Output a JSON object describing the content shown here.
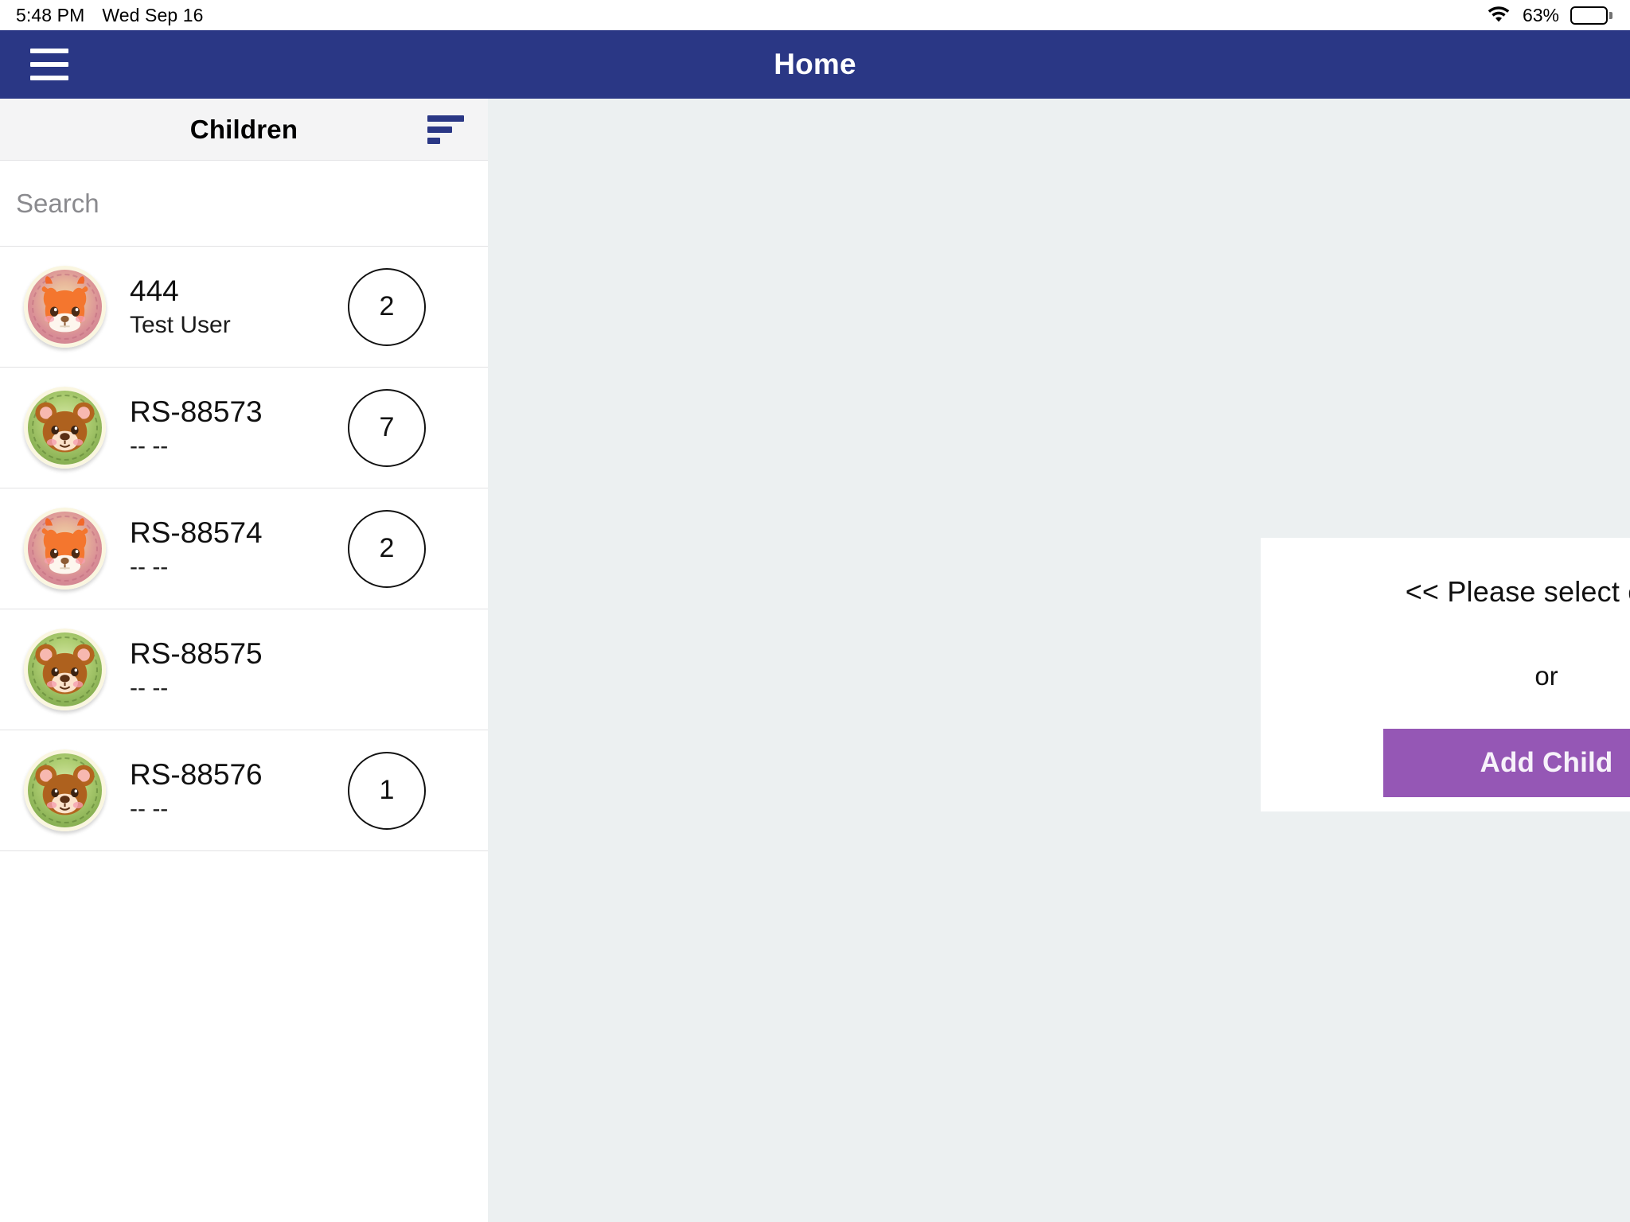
{
  "status_bar": {
    "time": "5:48 PM",
    "date": "Wed Sep 16",
    "wifi_icon": "wifi-icon",
    "battery_percent_label": "63%",
    "battery_level": 63,
    "battery_icon": "battery-icon"
  },
  "app_bar": {
    "menu_icon": "hamburger-menu-icon",
    "title": "Home",
    "background_color": "#2A3785"
  },
  "sidebar": {
    "title": "Children",
    "sort_icon": "sort-icon",
    "search": {
      "placeholder": "Search",
      "value": ""
    },
    "children": [
      {
        "name": "444",
        "subtitle": "Test User",
        "badge": "2",
        "has_badge": true,
        "avatar_icon": "squirrel-avatar-icon",
        "avatar_theme": "pink"
      },
      {
        "name": "RS-88573",
        "subtitle": "-- --",
        "badge": "7",
        "has_badge": true,
        "avatar_icon": "bear-avatar-icon",
        "avatar_theme": "green"
      },
      {
        "name": "RS-88574",
        "subtitle": "-- --",
        "badge": "2",
        "has_badge": true,
        "avatar_icon": "squirrel-avatar-icon",
        "avatar_theme": "pink"
      },
      {
        "name": "RS-88575",
        "subtitle": "-- --",
        "badge": "",
        "has_badge": false,
        "avatar_icon": "bear-avatar-icon",
        "avatar_theme": "green"
      },
      {
        "name": "RS-88576",
        "subtitle": "-- --",
        "badge": "1",
        "has_badge": true,
        "avatar_icon": "bear-avatar-icon",
        "avatar_theme": "green"
      }
    ]
  },
  "main": {
    "card": {
      "prompt": "<< Please select child",
      "or_label": "or",
      "add_child_label": "Add Child",
      "add_child_color": "#9557B5"
    },
    "background_color": "#ECF0F1"
  }
}
